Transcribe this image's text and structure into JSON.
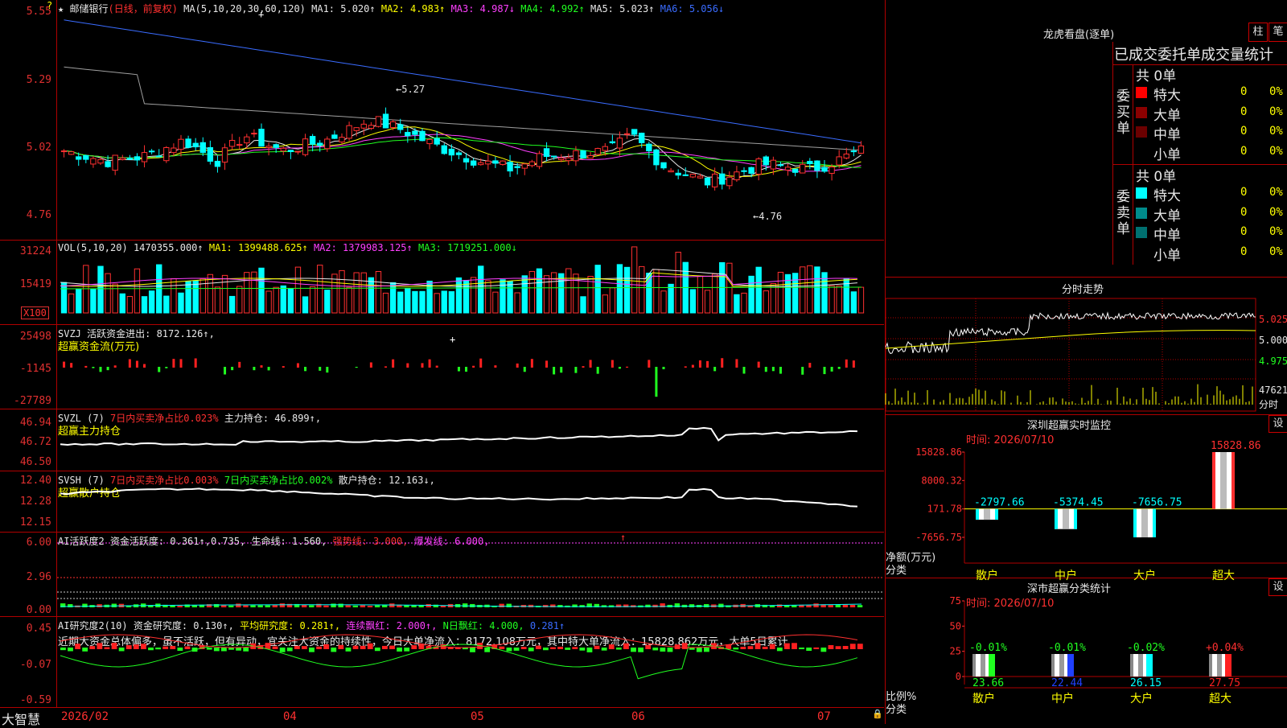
{
  "main": {
    "stock_name": "邮储银行",
    "period_tag": "(日线，前复权)",
    "ma_header": {
      "params": "MA(5,10,20,30,60,120)",
      "ma1": "MA1: 5.020↑",
      "ma2": "MA2: 4.983↑",
      "ma3": "MA3: 4.987↓",
      "ma4": "MA4: 4.992↑",
      "ma5": "MA5: 5.023↑",
      "ma6": "MA6: 5.056↓"
    },
    "y_ticks": [
      "5.55",
      "5.29",
      "5.02",
      "4.76"
    ],
    "annotations": {
      "high": "5.27",
      "low": "4.76"
    }
  },
  "volume": {
    "header": "VOL(5,10,20)",
    "vol": "1470355.000↑",
    "ma1": "MA1: 1399488.625↑",
    "ma2": "MA2: 1379983.125↑",
    "ma3": "MA3: 1719251.000↓",
    "y_ticks": [
      "31224",
      "15419"
    ],
    "unit": "X100"
  },
  "svzj": {
    "header": "SVZJ  活跃资金进出: 8172.126↑,",
    "subtitle": "超赢资金流(万元)",
    "y_ticks": [
      "25498",
      "-1145",
      "-27789"
    ]
  },
  "svzl": {
    "prefix": "SVZL (7)",
    "ratio": "7日内买卖净占比0.023%",
    "main": "主力持仓: 46.899↑,",
    "subtitle": "超赢主力持仓",
    "y_ticks": [
      "46.94",
      "46.72",
      "46.50"
    ]
  },
  "svsh": {
    "prefix": "SVSH (7)",
    "ratio1": "7日内买卖净占比0.003%",
    "ratio2": "7日内买卖净占比0.002%",
    "retail": "散户持仓: 12.163↓,",
    "subtitle": "超赢散户持仓",
    "y_ticks": [
      "12.40",
      "12.28",
      "12.15"
    ]
  },
  "ai_active": {
    "prefix": "AI活跃度2",
    "activity": "资金活跃度: 0.361↑,",
    "v2": "0.735,",
    "life": "生命线: 1.560,",
    "strong": "强势线: 3.000,",
    "burst": "爆发线: 6.000,",
    "y_ticks": [
      "6.00",
      "2.96",
      "0.00"
    ]
  },
  "ai_research": {
    "prefix": "AI研究度2(10)",
    "research": "资金研究度: 0.130↑,",
    "avg": "平均研究度: 0.281↑,",
    "cont": "连续飘红: 2.000↑,",
    "nday": "N日飘红: 4.000,",
    "last": "0.281↑",
    "commentary": "近期大资金总体偏多，虽不活跃，但有异动，宜关注大资金的持续性，今日大单净流入：8172.108万元，其中特大单净流入：15828.862万元，大单5日累计",
    "y_ticks": [
      "0.45",
      "-0.07",
      "-0.59"
    ]
  },
  "footer": {
    "brand": "大智慧",
    "dates": [
      "2026/02",
      "04",
      "05",
      "06",
      "07"
    ]
  },
  "lhb": {
    "title": "龙虎看盘(逐单)",
    "btn1": "柱",
    "btn2": "笔",
    "stats_title": "已成交委托单成交量统计",
    "buy": {
      "label": "委买单",
      "total": "共 0单",
      "rows": [
        {
          "name": "特大",
          "count": "0",
          "pct": "0%",
          "color": "#ff0000"
        },
        {
          "name": "大单",
          "count": "0",
          "pct": "0%",
          "color": "#8b0000"
        },
        {
          "name": "中单",
          "count": "0",
          "pct": "0%",
          "color": "#6b0000"
        },
        {
          "name": "小单",
          "count": "0",
          "pct": "0%",
          "color": ""
        }
      ]
    },
    "sell": {
      "label": "委卖单",
      "total": "共 0单",
      "rows": [
        {
          "name": "特大",
          "count": "0",
          "pct": "0%",
          "color": "#00ffff"
        },
        {
          "name": "大单",
          "count": "0",
          "pct": "0%",
          "color": "#008b8b"
        },
        {
          "name": "中单",
          "count": "0",
          "pct": "0%",
          "color": "#007070"
        },
        {
          "name": "小单",
          "count": "0",
          "pct": "0%",
          "color": ""
        }
      ]
    }
  },
  "intraday": {
    "title": "分时走势",
    "price_ticks": [
      "5.025",
      "5.000",
      "4.975"
    ],
    "vol_tick": "47621",
    "vol_label": "分时"
  },
  "sz_monitor": {
    "title": "深圳超赢实时监控",
    "btn": "设",
    "time": "时间: 2026/07/10",
    "y_ticks": [
      "15828.86",
      "8000.32",
      "171.78",
      "-7656.75"
    ],
    "y_label1": "净额(万元)",
    "y_label2": "分类",
    "chart_data": {
      "type": "bar",
      "categories": [
        "散户",
        "中户",
        "大户",
        "超大"
      ],
      "values": [
        -2797.66,
        -5374.45,
        -7656.75,
        15828.86
      ],
      "value_labels": [
        "-2797.66",
        "-5374.45",
        "-7656.75",
        "15828.86"
      ],
      "ylim": [
        -7656.75,
        15828.86
      ]
    }
  },
  "sz_class": {
    "title": "深市超赢分类统计",
    "btn": "设",
    "time": "时间: 2026/07/10",
    "y_ticks": [
      "75",
      "50",
      "25",
      "0"
    ],
    "y_label1": "比例%",
    "y_label2": "分类",
    "chart_data": {
      "type": "bar",
      "categories": [
        "散户",
        "中户",
        "大户",
        "超大"
      ],
      "values": [
        23.66,
        22.44,
        26.15,
        27.75
      ],
      "value_labels": [
        "23.66",
        "22.44",
        "26.15",
        "27.75"
      ],
      "changes": [
        "-0.01%",
        "-0.01%",
        "-0.02%",
        "+0.04%"
      ],
      "colors": [
        "#20ff20",
        "#2040ff",
        "#00ffff",
        "#ff2020"
      ],
      "ylim": [
        0,
        75
      ]
    }
  }
}
